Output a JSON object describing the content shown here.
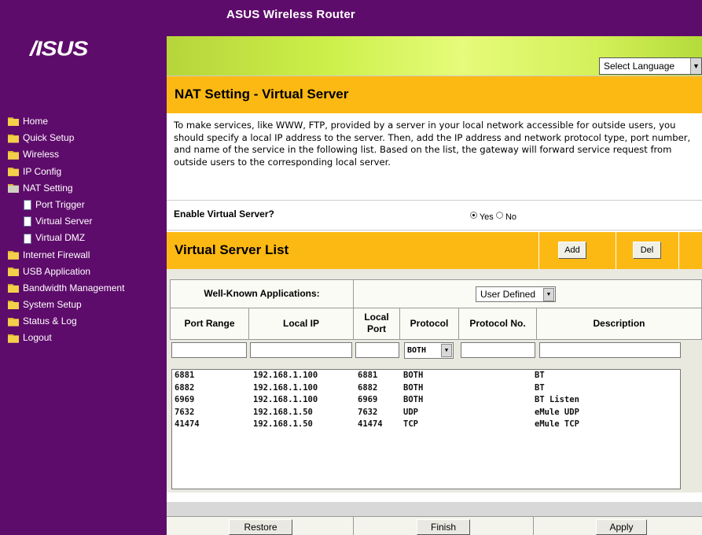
{
  "header": {
    "title": "ASUS Wireless Router",
    "logo": "/ISUS",
    "language": "Select Language"
  },
  "menu": [
    {
      "label": "Home",
      "icon": "folder-icon"
    },
    {
      "label": "Quick Setup",
      "icon": "folder-icon"
    },
    {
      "label": "Wireless",
      "icon": "folder-icon"
    },
    {
      "label": "IP Config",
      "icon": "folder-icon"
    },
    {
      "label": "NAT Setting",
      "icon": "open-folder-icon"
    },
    {
      "label": "Port Trigger",
      "icon": "document-icon"
    },
    {
      "label": "Virtual Server",
      "icon": "document-icon"
    },
    {
      "label": "Virtual DMZ",
      "icon": "document-icon"
    },
    {
      "label": "Internet Firewall",
      "icon": "folder-icon"
    },
    {
      "label": "USB Application",
      "icon": "folder-icon"
    },
    {
      "label": "Bandwidth Management",
      "icon": "folder-icon"
    },
    {
      "label": "System Setup",
      "icon": "folder-icon"
    },
    {
      "label": "Status & Log",
      "icon": "folder-icon"
    },
    {
      "label": "Logout",
      "icon": "folder-icon"
    }
  ],
  "section": {
    "title": "NAT Setting - Virtual Server",
    "description": "To make services, like WWW, FTP, provided by a server in your local network accessible for outside users, you should specify a local IP address to the server. Then, add the IP address and network protocol type, port number, and name of the service in the following list. Based on the list, the gateway will forward service request from outside users to the corresponding local server."
  },
  "enable": {
    "label": "Enable Virtual Server?",
    "yes": "Yes",
    "no": "No",
    "selected": "Yes"
  },
  "list": {
    "title": "Virtual Server List",
    "add": "Add",
    "del": "Del",
    "well_known_label": "Well-Known Applications:",
    "well_known_value": "User Defined",
    "headers": {
      "port_range": "Port Range",
      "local_ip": "Local IP",
      "local_port_1": "Local",
      "local_port_2": "Port",
      "protocol": "Protocol",
      "protocol_no": "Protocol No.",
      "description": "Description"
    },
    "protocol_default": "BOTH",
    "rows": [
      {
        "port_range": "6881",
        "local_ip": "192.168.1.100",
        "local_port": "6881",
        "protocol": "BOTH",
        "description": "BT"
      },
      {
        "port_range": "6882",
        "local_ip": "192.168.1.100",
        "local_port": "6882",
        "protocol": "BOTH",
        "description": "BT"
      },
      {
        "port_range": "6969",
        "local_ip": "192.168.1.100",
        "local_port": "6969",
        "protocol": "BOTH",
        "description": "BT Listen"
      },
      {
        "port_range": "7632",
        "local_ip": "192.168.1.50",
        "local_port": "7632",
        "protocol": "UDP",
        "description": "eMule UDP"
      },
      {
        "port_range": "41474",
        "local_ip": "192.168.1.50",
        "local_port": "41474",
        "protocol": "TCP",
        "description": "eMule TCP"
      }
    ]
  },
  "footer": {
    "restore": "Restore",
    "finish": "Finish",
    "apply": "Apply"
  }
}
